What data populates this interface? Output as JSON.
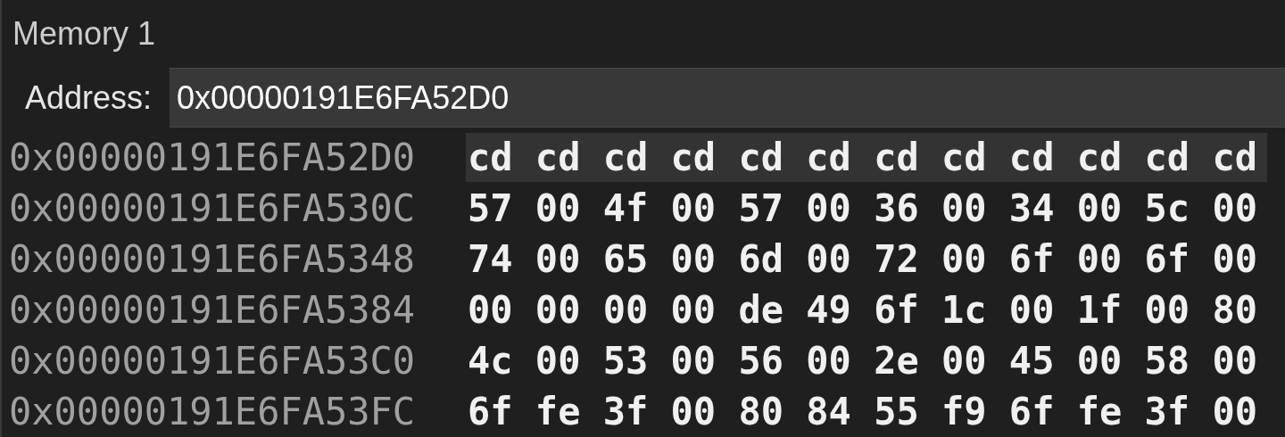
{
  "panel": {
    "title": "Memory 1"
  },
  "address_bar": {
    "label": "Address:",
    "value": "0x00000191E6FA52D0"
  },
  "rows": [
    {
      "address": "0x00000191E6FA52D0",
      "bytes": "cd cd cd cd cd cd cd cd cd cd cd cd",
      "selected": true
    },
    {
      "address": "0x00000191E6FA530C",
      "bytes": "57 00 4f 00 57 00 36 00 34 00 5c 00",
      "selected": false
    },
    {
      "address": "0x00000191E6FA5348",
      "bytes": "74 00 65 00 6d 00 72 00 6f 00 6f 00",
      "selected": false
    },
    {
      "address": "0x00000191E6FA5384",
      "bytes": "00 00 00 00 de 49 6f 1c 00 1f 00 80",
      "selected": false
    },
    {
      "address": "0x00000191E6FA53C0",
      "bytes": "4c 00 53 00 56 00 2e 00 45 00 58 00",
      "selected": false
    },
    {
      "address": "0x00000191E6FA53FC",
      "bytes": "6f fe 3f 00 80 84 55 f9 6f fe 3f 00",
      "selected": false
    }
  ]
}
